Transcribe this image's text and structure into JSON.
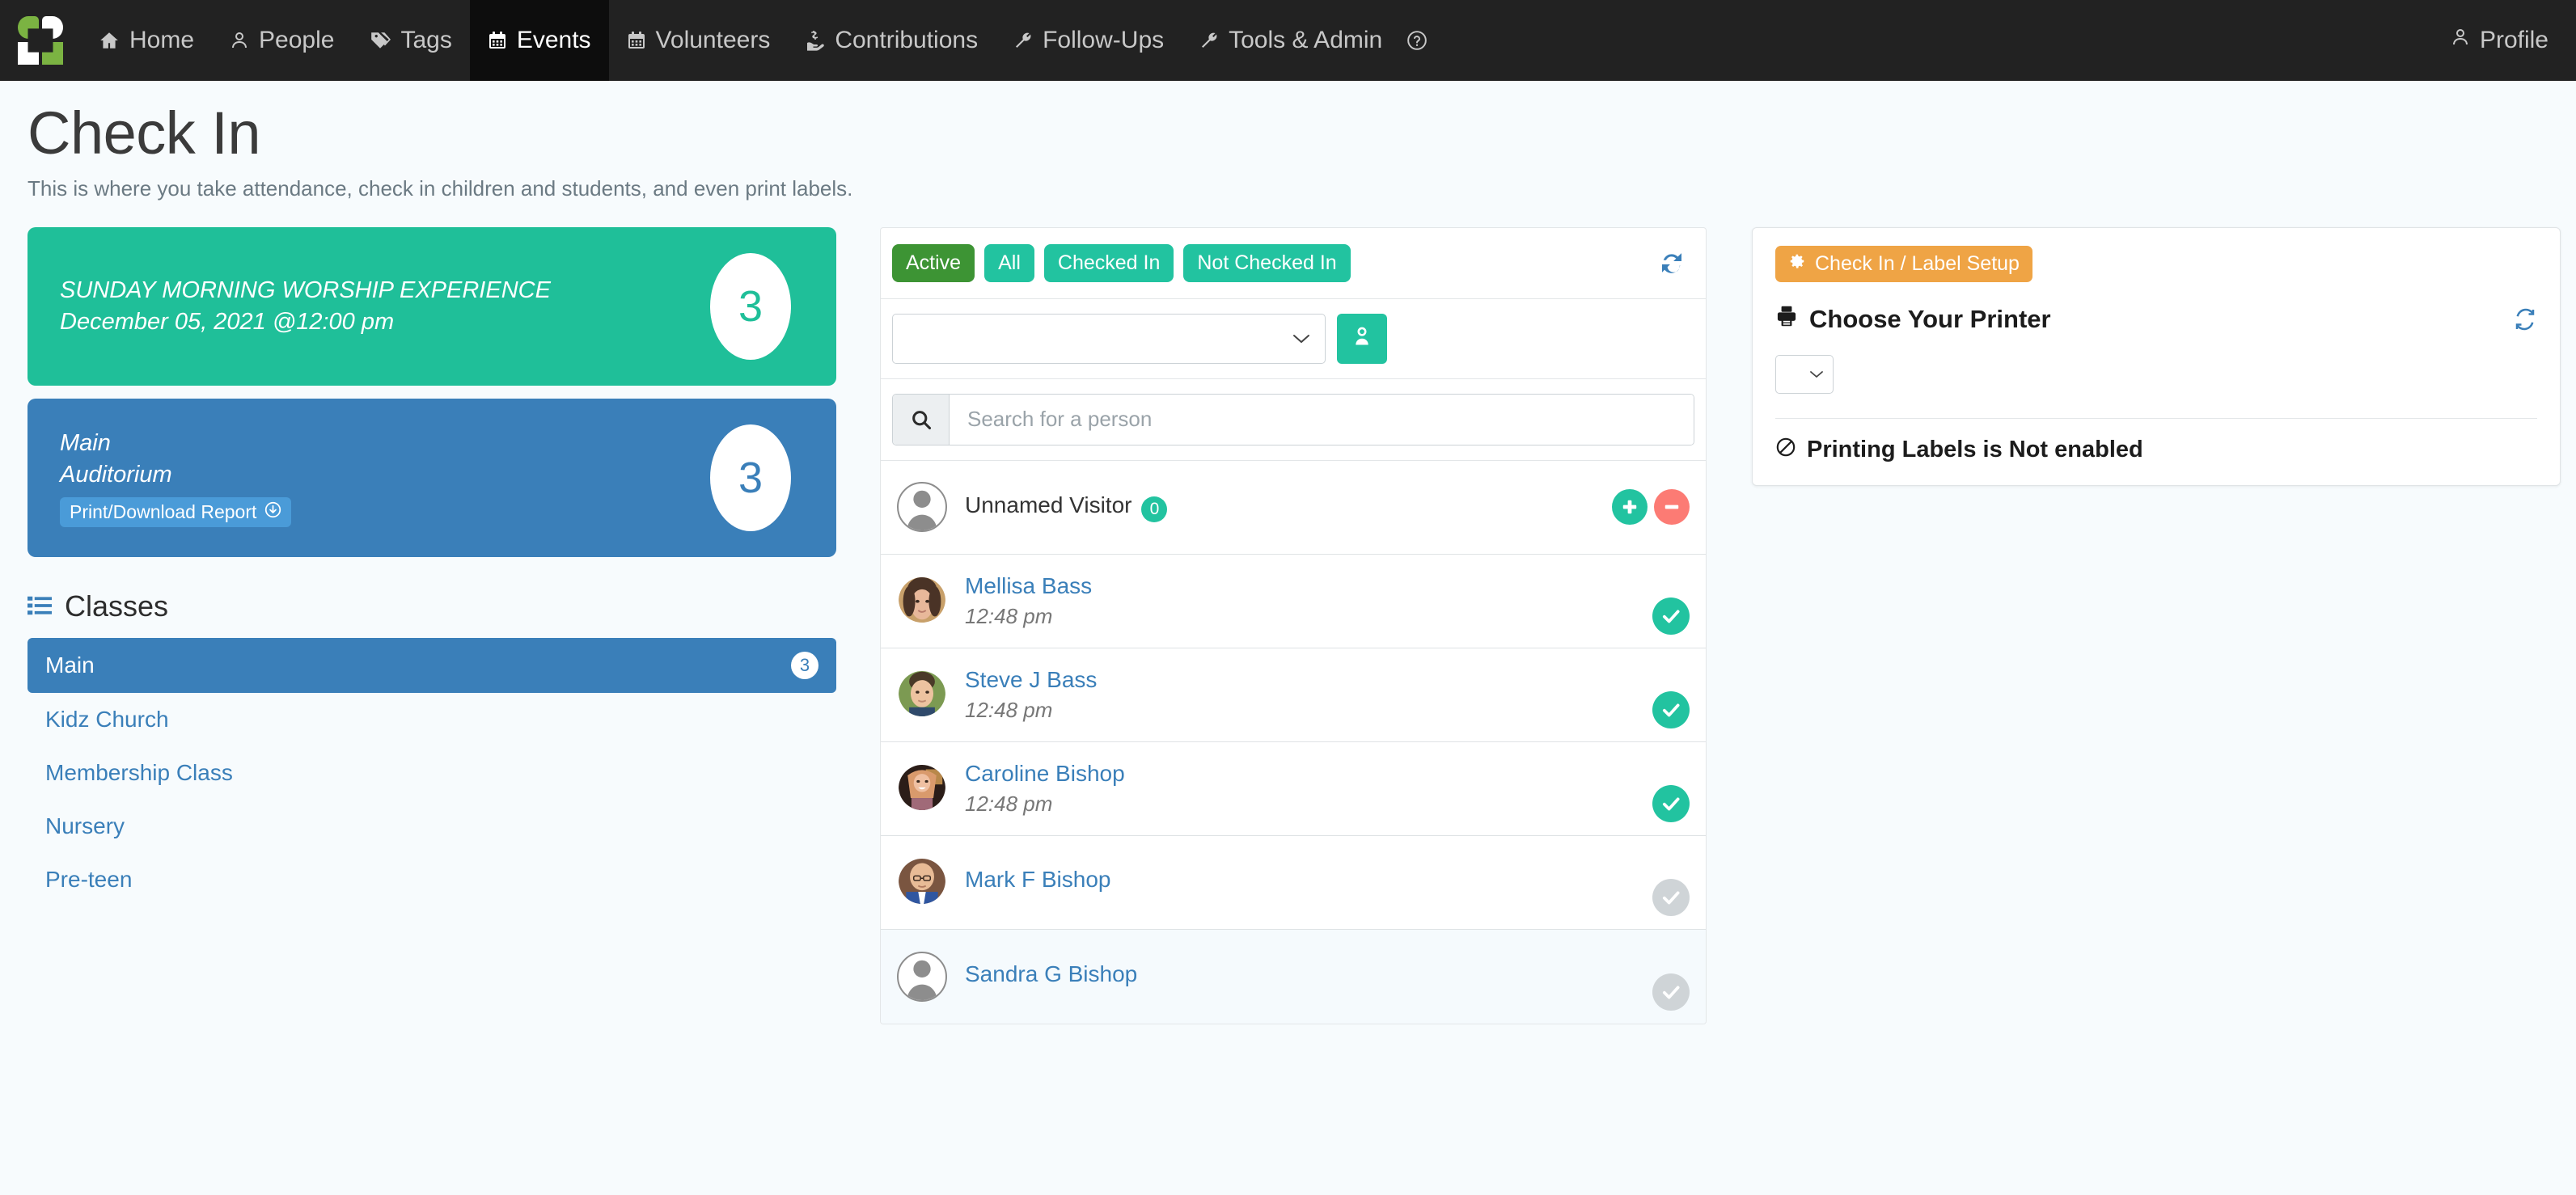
{
  "nav": {
    "logo_name": "app-logo",
    "items": [
      {
        "label": "Home",
        "icon": "home-icon",
        "active": false
      },
      {
        "label": "People",
        "icon": "person-icon",
        "active": false
      },
      {
        "label": "Tags",
        "icon": "tag-icon",
        "active": false
      },
      {
        "label": "Events",
        "icon": "calendar-icon",
        "active": true
      },
      {
        "label": "Volunteers",
        "icon": "calendar-icon",
        "active": false
      },
      {
        "label": "Contributions",
        "icon": "hand-dollar-icon",
        "active": false
      },
      {
        "label": "Follow-Ups",
        "icon": "wrench-icon",
        "active": false
      },
      {
        "label": "Tools & Admin",
        "icon": "wrench-icon",
        "active": false
      }
    ],
    "help_icon": "question-circle-icon",
    "profile_label": "Profile",
    "profile_icon": "person-icon"
  },
  "header": {
    "title": "Check In",
    "subtitle": "This is where you take attendance, check in children and students, and even print labels."
  },
  "event_cards": [
    {
      "line1": "SUNDAY MORNING WORSHIP EXPERIENCE",
      "line2": "December 05, 2021 @12:00 pm",
      "count": "3",
      "color": "#1fbf99"
    },
    {
      "line1": "Main",
      "line2": "Auditorium",
      "report_label": "Print/Download Report",
      "count": "3",
      "color": "#3a7fb9"
    }
  ],
  "classes": {
    "heading": "Classes",
    "heading_icon": "list-icon",
    "items": [
      {
        "label": "Main",
        "count": "3",
        "active": true
      },
      {
        "label": "Kidz Church",
        "count": "",
        "active": false
      },
      {
        "label": "Membership Class",
        "count": "",
        "active": false
      },
      {
        "label": "Nursery",
        "count": "",
        "active": false
      },
      {
        "label": "Pre-teen",
        "count": "",
        "active": false
      }
    ]
  },
  "center": {
    "filters": [
      {
        "label": "Active",
        "selected": true
      },
      {
        "label": "All",
        "selected": false
      },
      {
        "label": "Checked In",
        "selected": false
      },
      {
        "label": "Not Checked In",
        "selected": false
      }
    ],
    "refresh_icon": "refresh-icon",
    "class_select_value": "",
    "add_person_icon": "add-person-icon",
    "search_placeholder": "Search for a person",
    "search_value": "",
    "search_icon": "search-icon",
    "people": [
      {
        "name": "Unnamed Visitor",
        "time": "",
        "badge": "0",
        "avatar": "placeholder",
        "actions": [
          "plus",
          "minus"
        ],
        "checked": null,
        "alt": false
      },
      {
        "name": "Mellisa Bass",
        "time": "12:48 pm",
        "badge": "",
        "avatar": "photo-female-1",
        "actions": [],
        "checked": true,
        "alt": false
      },
      {
        "name": "Steve J Bass",
        "time": "12:48 pm",
        "badge": "",
        "avatar": "photo-male-1",
        "actions": [],
        "checked": true,
        "alt": false
      },
      {
        "name": "Caroline Bishop",
        "time": "12:48 pm",
        "badge": "",
        "avatar": "photo-female-2",
        "actions": [],
        "checked": true,
        "alt": false
      },
      {
        "name": "Mark F Bishop",
        "time": "",
        "badge": "",
        "avatar": "photo-male-2",
        "actions": [],
        "checked": false,
        "alt": false
      },
      {
        "name": "Sandra G Bishop",
        "time": "",
        "badge": "",
        "avatar": "placeholder",
        "actions": [],
        "checked": false,
        "alt": true
      }
    ]
  },
  "right": {
    "setup_label": "Check In / Label Setup",
    "setup_icon": "gear-icon",
    "printer_title": "Choose Your Printer",
    "printer_icon": "printer-icon",
    "refresh_icon": "refresh-icon",
    "printer_value": "",
    "status_text": "Printing Labels is Not enabled",
    "status_icon": "ban-icon"
  },
  "colors": {
    "nav_bg": "#222222",
    "nav_active_bg": "#0d0d0d",
    "page_bg": "#f7fbfd",
    "teal": "#1fbf99",
    "green": "#22c3a0",
    "green_selected": "#3d9434",
    "blue": "#3a7fb9",
    "blue_light": "#4a9bd8",
    "orange": "#efa445",
    "red": "#fc7b74",
    "grey_disabled": "#cfd4d7"
  }
}
